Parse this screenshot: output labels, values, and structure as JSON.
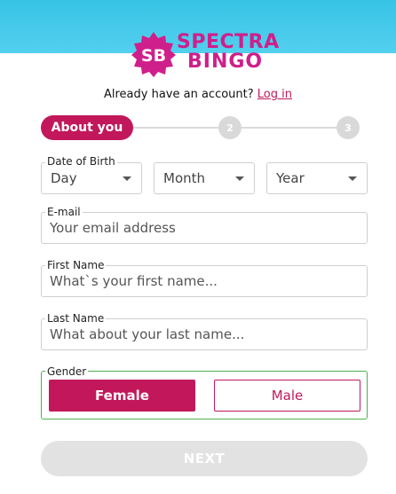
{
  "brand": {
    "badge_text": "SB",
    "name_line1": "SPECTRA",
    "name_line2": "BINGO",
    "color": "#cf1f8b"
  },
  "login_prompt": {
    "text": "Already have an account?",
    "link_label": "Log in"
  },
  "stepper": {
    "active_label": "About you",
    "step2": "2",
    "step3": "3"
  },
  "dob": {
    "label": "Date of Birth",
    "day": "Day",
    "month": "Month",
    "year": "Year"
  },
  "email": {
    "label": "E-mail",
    "placeholder": "Your email address"
  },
  "first_name": {
    "label": "First Name",
    "placeholder": "What`s your first name..."
  },
  "last_name": {
    "label": "Last Name",
    "placeholder": "What about your last name..."
  },
  "gender": {
    "label": "Gender",
    "female": "Female",
    "male": "Male",
    "selected": "Female"
  },
  "next_label": "NEXT",
  "colors": {
    "accent": "#c2185b",
    "header": "#37c3e6",
    "valid_border": "#4caf50"
  }
}
